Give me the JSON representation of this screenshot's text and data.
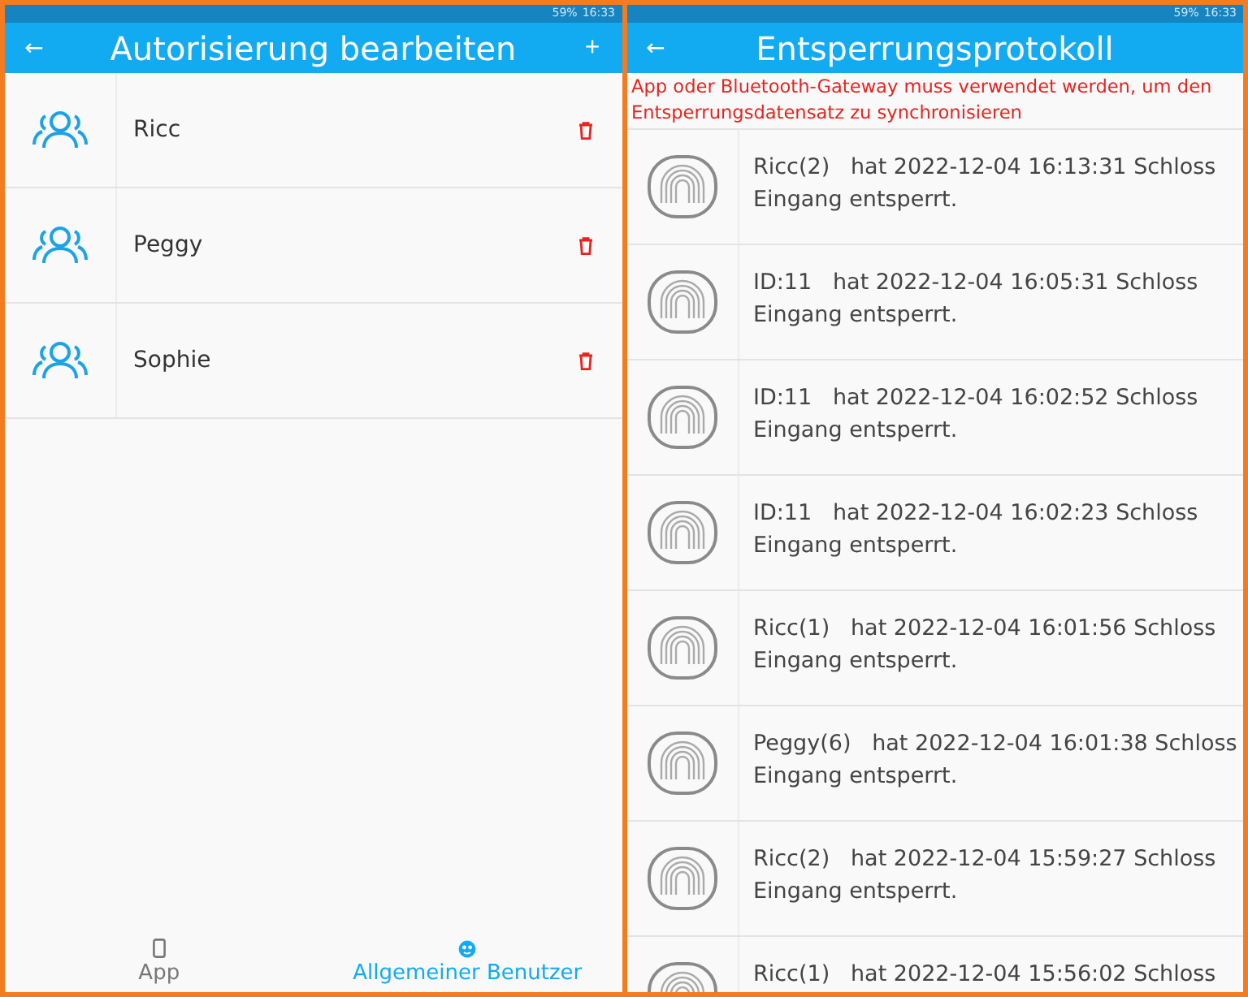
{
  "left": {
    "status_bar": {
      "battery": "59%",
      "time": "16:33"
    },
    "title": "Autorisierung bearbeiten",
    "back": "←",
    "add": "+",
    "users": [
      {
        "name": "Ricc"
      },
      {
        "name": "Peggy"
      },
      {
        "name": "Sophie"
      }
    ],
    "tabs": [
      {
        "label": "App",
        "kind": "device",
        "selected": false
      },
      {
        "label": "Allgemeiner Benutzer",
        "kind": "general",
        "selected": true
      }
    ]
  },
  "right": {
    "status_bar": {
      "battery": "59%",
      "time": "16:33"
    },
    "title": "Entsperrungsprotokoll",
    "back": "←",
    "warning": "App oder Bluetooth-Gateway muss verwendet werden, um den Entsperrungsdatensatz zu synchronisieren",
    "entries": [
      {
        "who": "Ricc(2)",
        "text": "hat 2022-12-04 16:13:31 Schloss",
        "line2": "Eingang entsperrt."
      },
      {
        "who": "ID:11",
        "text": "hat 2022-12-04 16:05:31 Schloss",
        "line2": "Eingang entsperrt."
      },
      {
        "who": "ID:11",
        "text": "hat 2022-12-04 16:02:52 Schloss",
        "line2": "Eingang entsperrt."
      },
      {
        "who": "ID:11",
        "text": "hat 2022-12-04 16:02:23 Schloss",
        "line2": "Eingang entsperrt."
      },
      {
        "who": "Ricc(1)",
        "text": "hat 2022-12-04 16:01:56 Schloss",
        "line2": "Eingang entsperrt."
      },
      {
        "who": "Peggy(6)",
        "text": "hat 2022-12-04 16:01:38 Schloss",
        "line2": "Eingang entsperrt."
      },
      {
        "who": "Ricc(2)",
        "text": "hat 2022-12-04 15:59:27 Schloss",
        "line2": "Eingang entsperrt."
      },
      {
        "who": "Ricc(1)",
        "text": "hat 2022-12-04 15:56:02 Schloss"
      }
    ]
  }
}
